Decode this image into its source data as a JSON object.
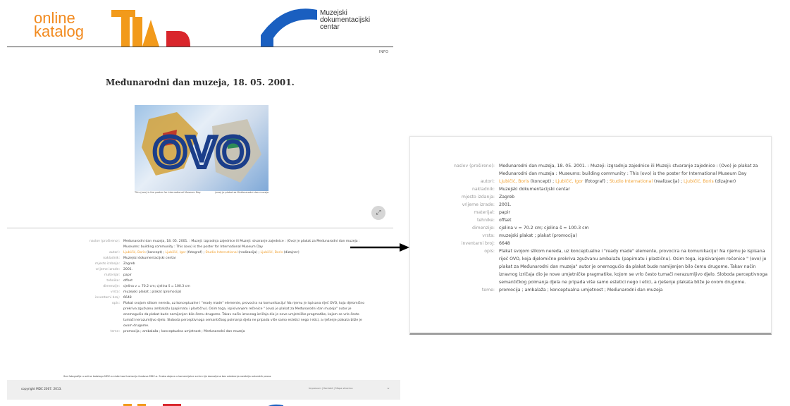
{
  "header": {
    "logo_line1": "online",
    "logo_line2": "katalog",
    "mdc_line1": "Muzejski",
    "mdc_line2": "dokumentacijski",
    "mdc_line3": "centar",
    "info_link": "INFO"
  },
  "record": {
    "title": "Međunarodni dan muzeja, 18. 05. 2001.",
    "poster_text": "OVO",
    "caption_left": "This (ovo) is the poster for International Museum Day",
    "caption_right": "(ovo) je plakat za Međunarodni dan muzeja",
    "fields": [
      {
        "label": "naslov (prošireno):",
        "value": "Međunarodni dan muzeja, 18. 05. 2001. : Muzeji: izgradnja zajednice ili Muzeji: stvaranje zajednice : (Ovo) je plakat za Međunarodni dan muzeja : Museums: building community : This (ovo) is the poster for International Museum Day",
        "link": false
      },
      {
        "label": "autori:",
        "value": "Ljubičić, Boris (koncept) ; Ljubičić, Igor (fotograf) ; Studio International (realizacija) ; Ljubičić, Boris (dizajner)",
        "link": "mixed"
      },
      {
        "label": "nakladnik:",
        "value": "Muzejski dokumentacijski centar",
        "link": true
      },
      {
        "label": "mjesto izdanja:",
        "value": "Zagreb",
        "link": true
      },
      {
        "label": "vrijeme izrade:",
        "value": "2001.",
        "link": false
      },
      {
        "label": "materijal:",
        "value": "papir",
        "link": true
      },
      {
        "label": "tehnike:",
        "value": "offset",
        "link": true
      },
      {
        "label": "dimenzije:",
        "value": "cjelina v = 70.2 cm; cjelina š = 100.3 cm",
        "link": false
      },
      {
        "label": "vrsta:",
        "value": "muzejski plakat ; plakat (promocija)",
        "link": true
      },
      {
        "label": "inventarni broj:",
        "value": "6648",
        "link": false
      },
      {
        "label": "opis:",
        "value": "Plakat svojom slikom nereda, uz konceptualne i \"ready made\" elemente, provocira na komunikaciju! Na njemu je ispisana riječ OVO, koja djelomično prekriva zgužvanu ambalažu (papirnatu i plastičnu). Osim toga, ispisivanjem rečenice \" (ovo) je plakat za Međunarodni dan muzeja\" autor je onemogućio da plakat bude namijenjen bilo čemu drugome. Takav način izravnog izričaja dio je nove umjetničke pragmatike, kojom se vrlo često tumači nerazumljivo djelo. Sloboda perceptivnoga semantičkog poimanja djela ne pripada više samo estetici nego i etici, a rješenje plakata bliže je ovom drugome.",
        "link": false
      },
      {
        "label": "teme:",
        "value": "promocija ; ambalaža ; konceptualna umjetnost ; Međunarodni dan muzeja",
        "link": true
      }
    ],
    "authors": {
      "a1": "Ljubičić, Boris",
      "r1": " (koncept) ; ",
      "a2": "Ljubičić, Igor",
      "r2": " (fotograf) ; ",
      "a3": "Studio International",
      "r3": " (realizacija) ; ",
      "a4": "Ljubičić, Boris",
      "r4": " (dizajner)"
    }
  },
  "footer": {
    "note": "Sve fotografije u online katalogu MDC-a služe kao ilustracija fondova MDC-a. Svaka objava u komercijalne svrhe nije dozvoljena bez odobrenja nositelja autorskih prava.",
    "copyright": "copyright MDC 2007. 2013.",
    "right_links": "Impresum | Kontakt | Mapa stranica"
  },
  "colors": {
    "accent": "#f0a030",
    "logo_orange": "#f28a1e",
    "mdc_blue": "#1a5fc0"
  }
}
